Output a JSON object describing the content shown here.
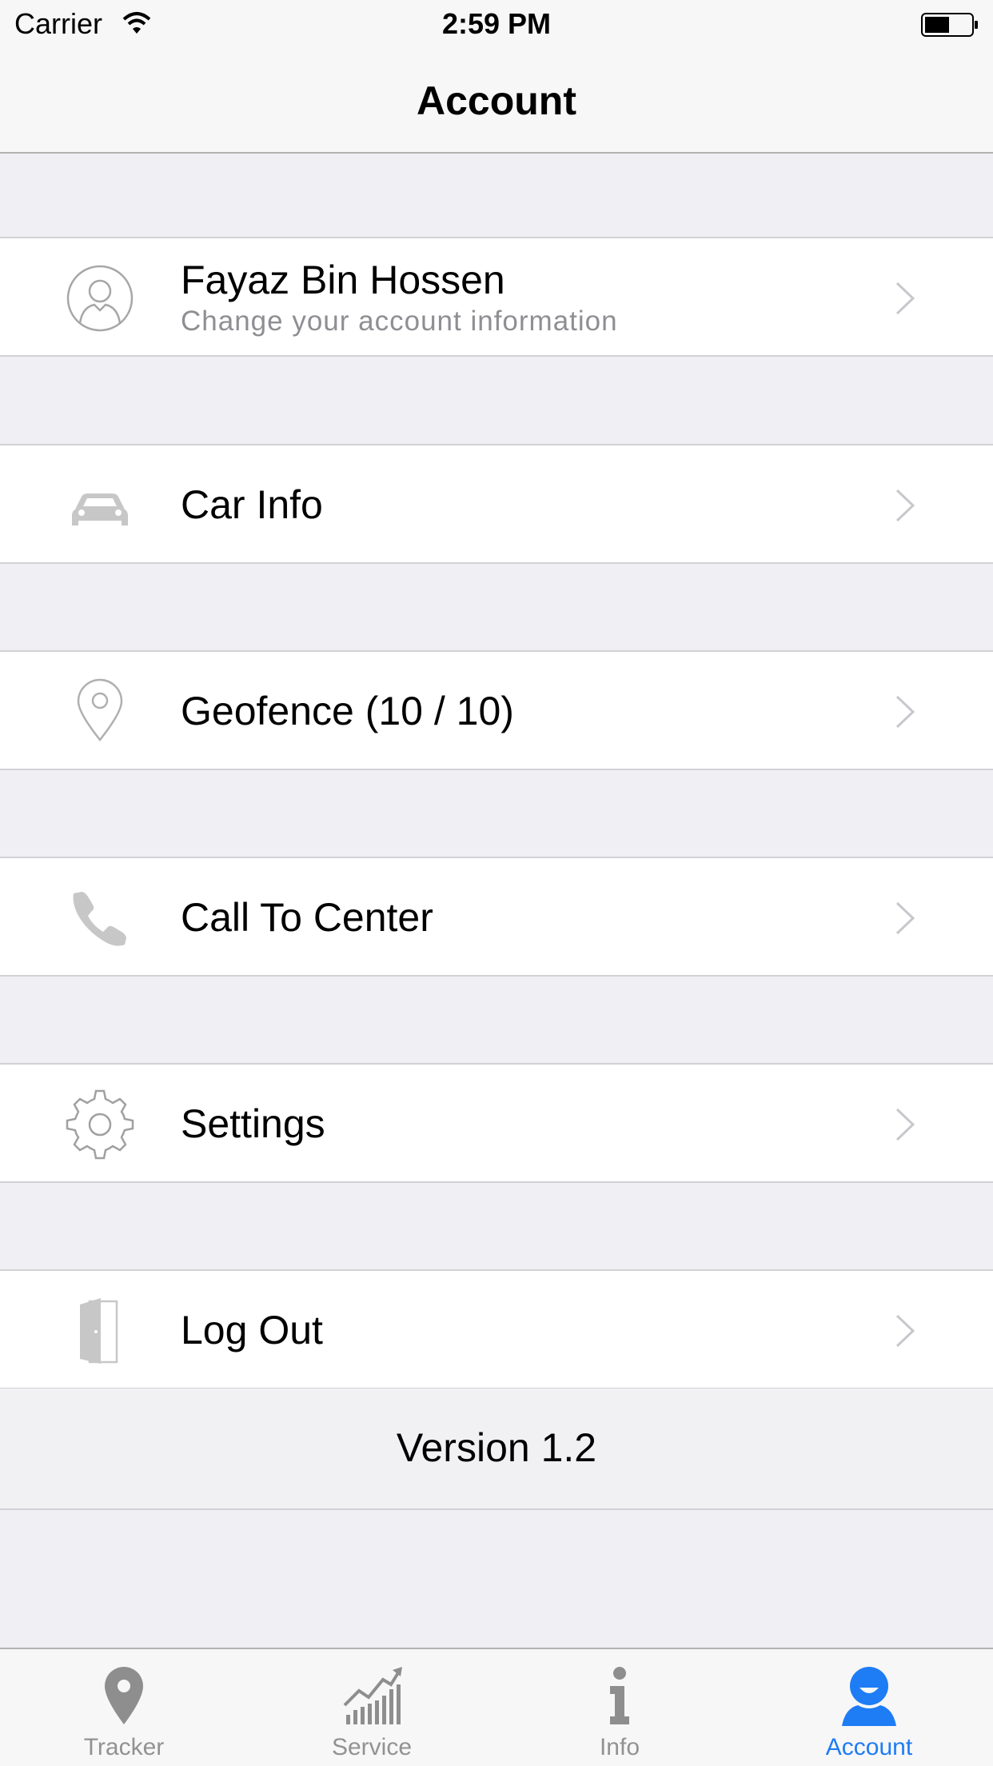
{
  "status_bar": {
    "carrier": "Carrier",
    "time": "2:59 PM"
  },
  "nav": {
    "title": "Account"
  },
  "profile": {
    "name": "Fayaz Bin Hossen",
    "subtitle": "Change your account information",
    "icon": "user-icon"
  },
  "menu": [
    {
      "label": "Car Info",
      "icon": "car-icon"
    },
    {
      "label": "Geofence (10 / 10)",
      "icon": "location-pin-icon"
    },
    {
      "label": "Call To Center",
      "icon": "phone-icon"
    },
    {
      "label": "Settings",
      "icon": "gear-icon"
    },
    {
      "label": "Log Out",
      "icon": "door-icon"
    }
  ],
  "version": "Version 1.2",
  "tabs": [
    {
      "label": "Tracker",
      "icon": "map-pin-icon",
      "active": false
    },
    {
      "label": "Service",
      "icon": "chart-icon",
      "active": false
    },
    {
      "label": "Info",
      "icon": "info-icon",
      "active": false
    },
    {
      "label": "Account",
      "icon": "account-icon",
      "active": true
    }
  ],
  "colors": {
    "accent": "#1e7cf5",
    "inactive": "#929292",
    "background": "#efeff4"
  }
}
